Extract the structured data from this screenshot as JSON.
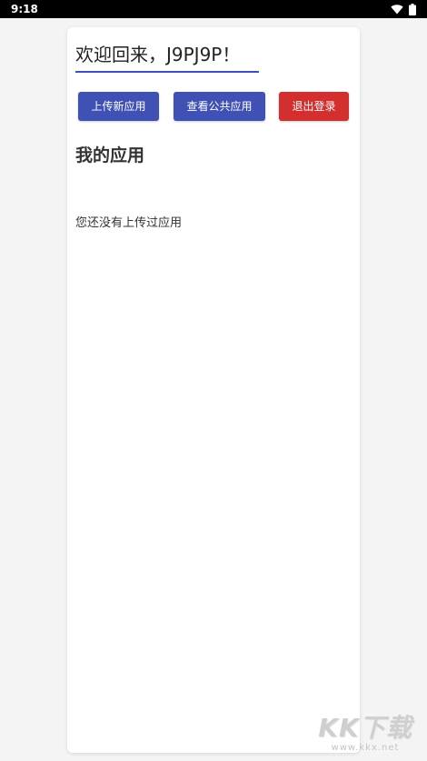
{
  "status_bar": {
    "time": "9:18",
    "icons": [
      "wifi-icon",
      "battery-icon"
    ]
  },
  "header": {
    "welcome": "欢迎回来，J9PJ9P！"
  },
  "actions": {
    "upload_label": "上传新应用",
    "public_label": "查看公共应用",
    "logout_label": "退出登录"
  },
  "my_apps": {
    "title": "我的应用",
    "empty_message": "您还没有上传过应用"
  },
  "watermark": {
    "logo_text": "KK下载",
    "url": "www.kkx.net"
  },
  "colors": {
    "primary": "#3f51b5",
    "danger": "#d32f2f",
    "background": "#f4f4f4",
    "card": "#ffffff"
  }
}
